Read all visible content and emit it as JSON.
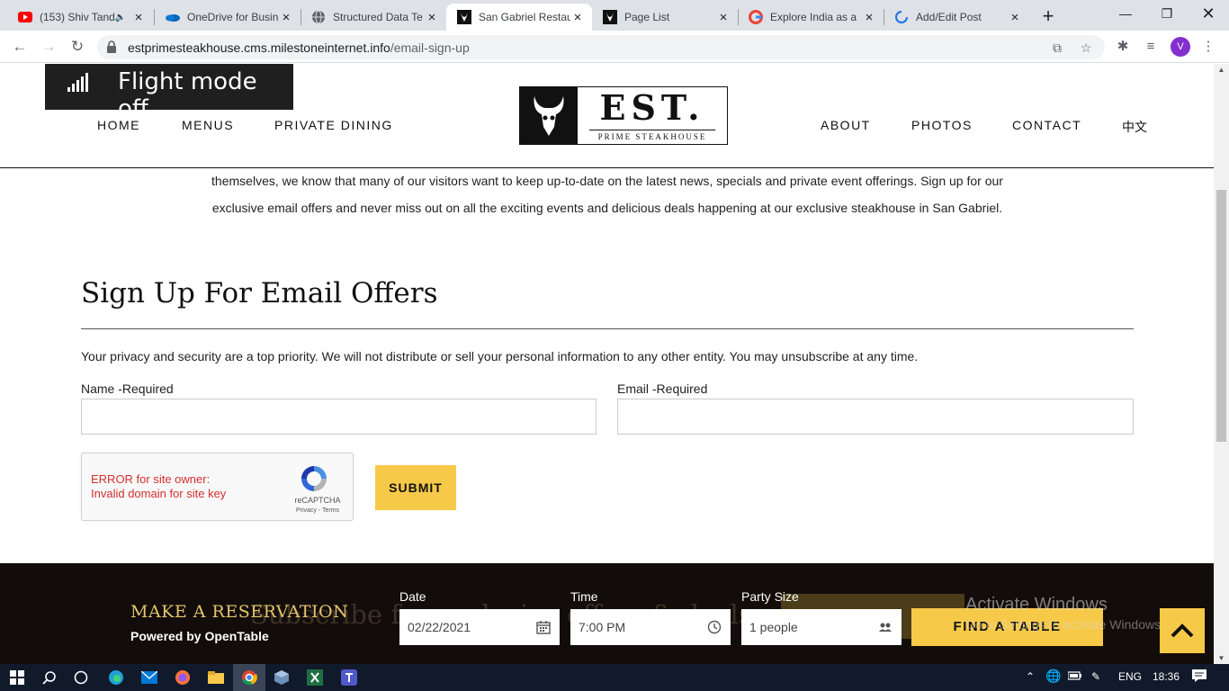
{
  "browser": {
    "tabs": [
      {
        "title": "(153) Shiv Tand",
        "favicon": "youtube-icon"
      },
      {
        "title": "OneDrive for Busin",
        "favicon": "onedrive-icon"
      },
      {
        "title": "Structured Data Te",
        "favicon": "globe-icon"
      },
      {
        "title": "San Gabriel Restau",
        "favicon": "est-logo-icon",
        "active": true
      },
      {
        "title": "Page List",
        "favicon": "est-logo-icon"
      },
      {
        "title": "Explore India as a",
        "favicon": "google-icon"
      },
      {
        "title": "Add/Edit Post",
        "favicon": "loading-spinner-icon"
      }
    ],
    "url_host": "estprimesteakhouse.cms.milestoneinternet.info",
    "url_path": "/email-sign-up",
    "profile_initial": "V"
  },
  "toast": {
    "text": "Flight mode off"
  },
  "site": {
    "nav_left": [
      "HOME",
      "MENUS",
      "PRIVATE DINING"
    ],
    "nav_right": [
      "ABOUT",
      "PHOTOS",
      "CONTACT",
      "中文"
    ],
    "logo_text": "EST.",
    "logo_sub": "PRIME STEAKHOUSE"
  },
  "content": {
    "intro_line1": "themselves, we know that many of our visitors want to keep up-to-date on the latest news, specials and private event offerings. Sign up for our",
    "intro_line2": "exclusive email offers and never miss out on all the exciting events and delicious deals happening at our exclusive steakhouse in San Gabriel.",
    "title": "Sign Up For Email Offers",
    "privacy": "Your privacy and security are a top priority. We will not distribute or sell your personal information to any other entity. You may unsubscribe at any time.",
    "name_label": "Name -Required",
    "email_label": "Email -Required",
    "captcha_error_1": "ERROR for site owner:",
    "captcha_error_2": "Invalid domain for site key",
    "captcha_brand": "reCAPTCHA",
    "captcha_links": "Privacy - Terms",
    "submit": "SUBMIT"
  },
  "reservation": {
    "title": "MAKE A RESERVATION",
    "powered": "Powered by OpenTable",
    "ghost_text": "Subscribe for exclusive offers & deals",
    "date_label": "Date",
    "date_value": "02/22/2021",
    "time_label": "Time",
    "time_value": "7:00 PM",
    "party_label": "Party Size",
    "party_value": "1 people",
    "find": "FIND A TABLE"
  },
  "watermark": {
    "line1": "Activate Windows",
    "line2": "Go to Settings to activate Windows."
  },
  "taskbar": {
    "lang": "ENG",
    "time": "18:36"
  }
}
